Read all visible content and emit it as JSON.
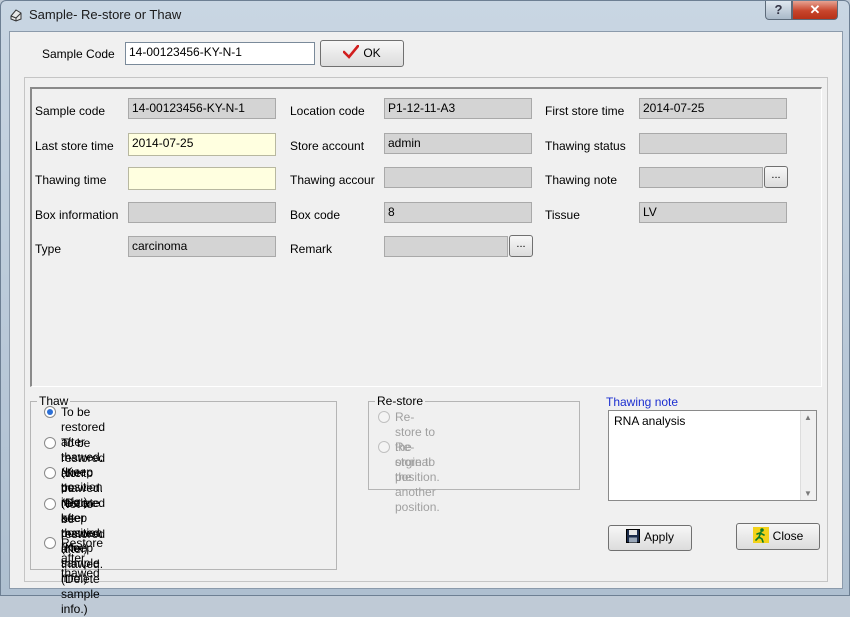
{
  "window": {
    "title": "Sample- Re-store or Thaw",
    "help_label": "?",
    "close_label": "✕"
  },
  "top_bar": {
    "sample_code_label": "Sample Code",
    "sample_code_value": "14-00123456-KY-N-1",
    "ok_label": "OK"
  },
  "details": {
    "sample_code": {
      "label": "Sample code",
      "value": "14-00123456-KY-N-1"
    },
    "location_code": {
      "label": "Location code",
      "value": "P1-12-11-A3"
    },
    "first_store_time": {
      "label": "First store time",
      "value": "2014-07-25"
    },
    "last_store_time": {
      "label": "Last store time",
      "value": "2014-07-25"
    },
    "store_account": {
      "label": "Store account",
      "value": "admin"
    },
    "thawing_status": {
      "label": "Thawing status",
      "value": ""
    },
    "thawing_time": {
      "label": "Thawing time",
      "value": ""
    },
    "thawing_account": {
      "label": "Thawing accour",
      "value": ""
    },
    "thawing_note": {
      "label": "Thawing note",
      "value": ""
    },
    "box_information": {
      "label": "Box information",
      "value": ""
    },
    "box_code": {
      "label": "Box code",
      "value": "8"
    },
    "tissue": {
      "label": "Tissue",
      "value": "LV"
    },
    "type": {
      "label": "Type",
      "value": "carcinoma"
    },
    "remark": {
      "label": "Remark",
      "value": ""
    },
    "ellipsis_label": "..."
  },
  "thaw_group": {
    "legend": "Thaw",
    "options": [
      {
        "line1": "To be restored after thawed.(Keep",
        "line2": "position info.)",
        "checked": true
      },
      {
        "line1": "To be restored after thawed.(Delete keep",
        "line2": "position info.)",
        "checked": false
      },
      {
        "line1": "Not to be restored after thawed.(Keep",
        "line2": "sample info.)",
        "checked": false
      },
      {
        "line1": "Not to be restored after thawed.(Delete",
        "line2": "sample info.)",
        "checked": false
      },
      {
        "line1": "Restore after thawed",
        "line2": "",
        "checked": false
      }
    ]
  },
  "restore_group": {
    "legend": "Re-store",
    "options": [
      {
        "line1": "Re-store to the orginal",
        "line2": "position."
      },
      {
        "line1": "Re-store to the another",
        "line2": "position."
      }
    ]
  },
  "note_panel": {
    "label": "Thawing note",
    "text": "RNA analysis"
  },
  "actions": {
    "apply_label": "Apply",
    "close_label": "Close"
  },
  "colors": {
    "yellow_field": "#ffffe0",
    "disabled_field": "#d4d4d4",
    "note_label": "#1c2fd0",
    "ok_check": "#d11e1e"
  }
}
